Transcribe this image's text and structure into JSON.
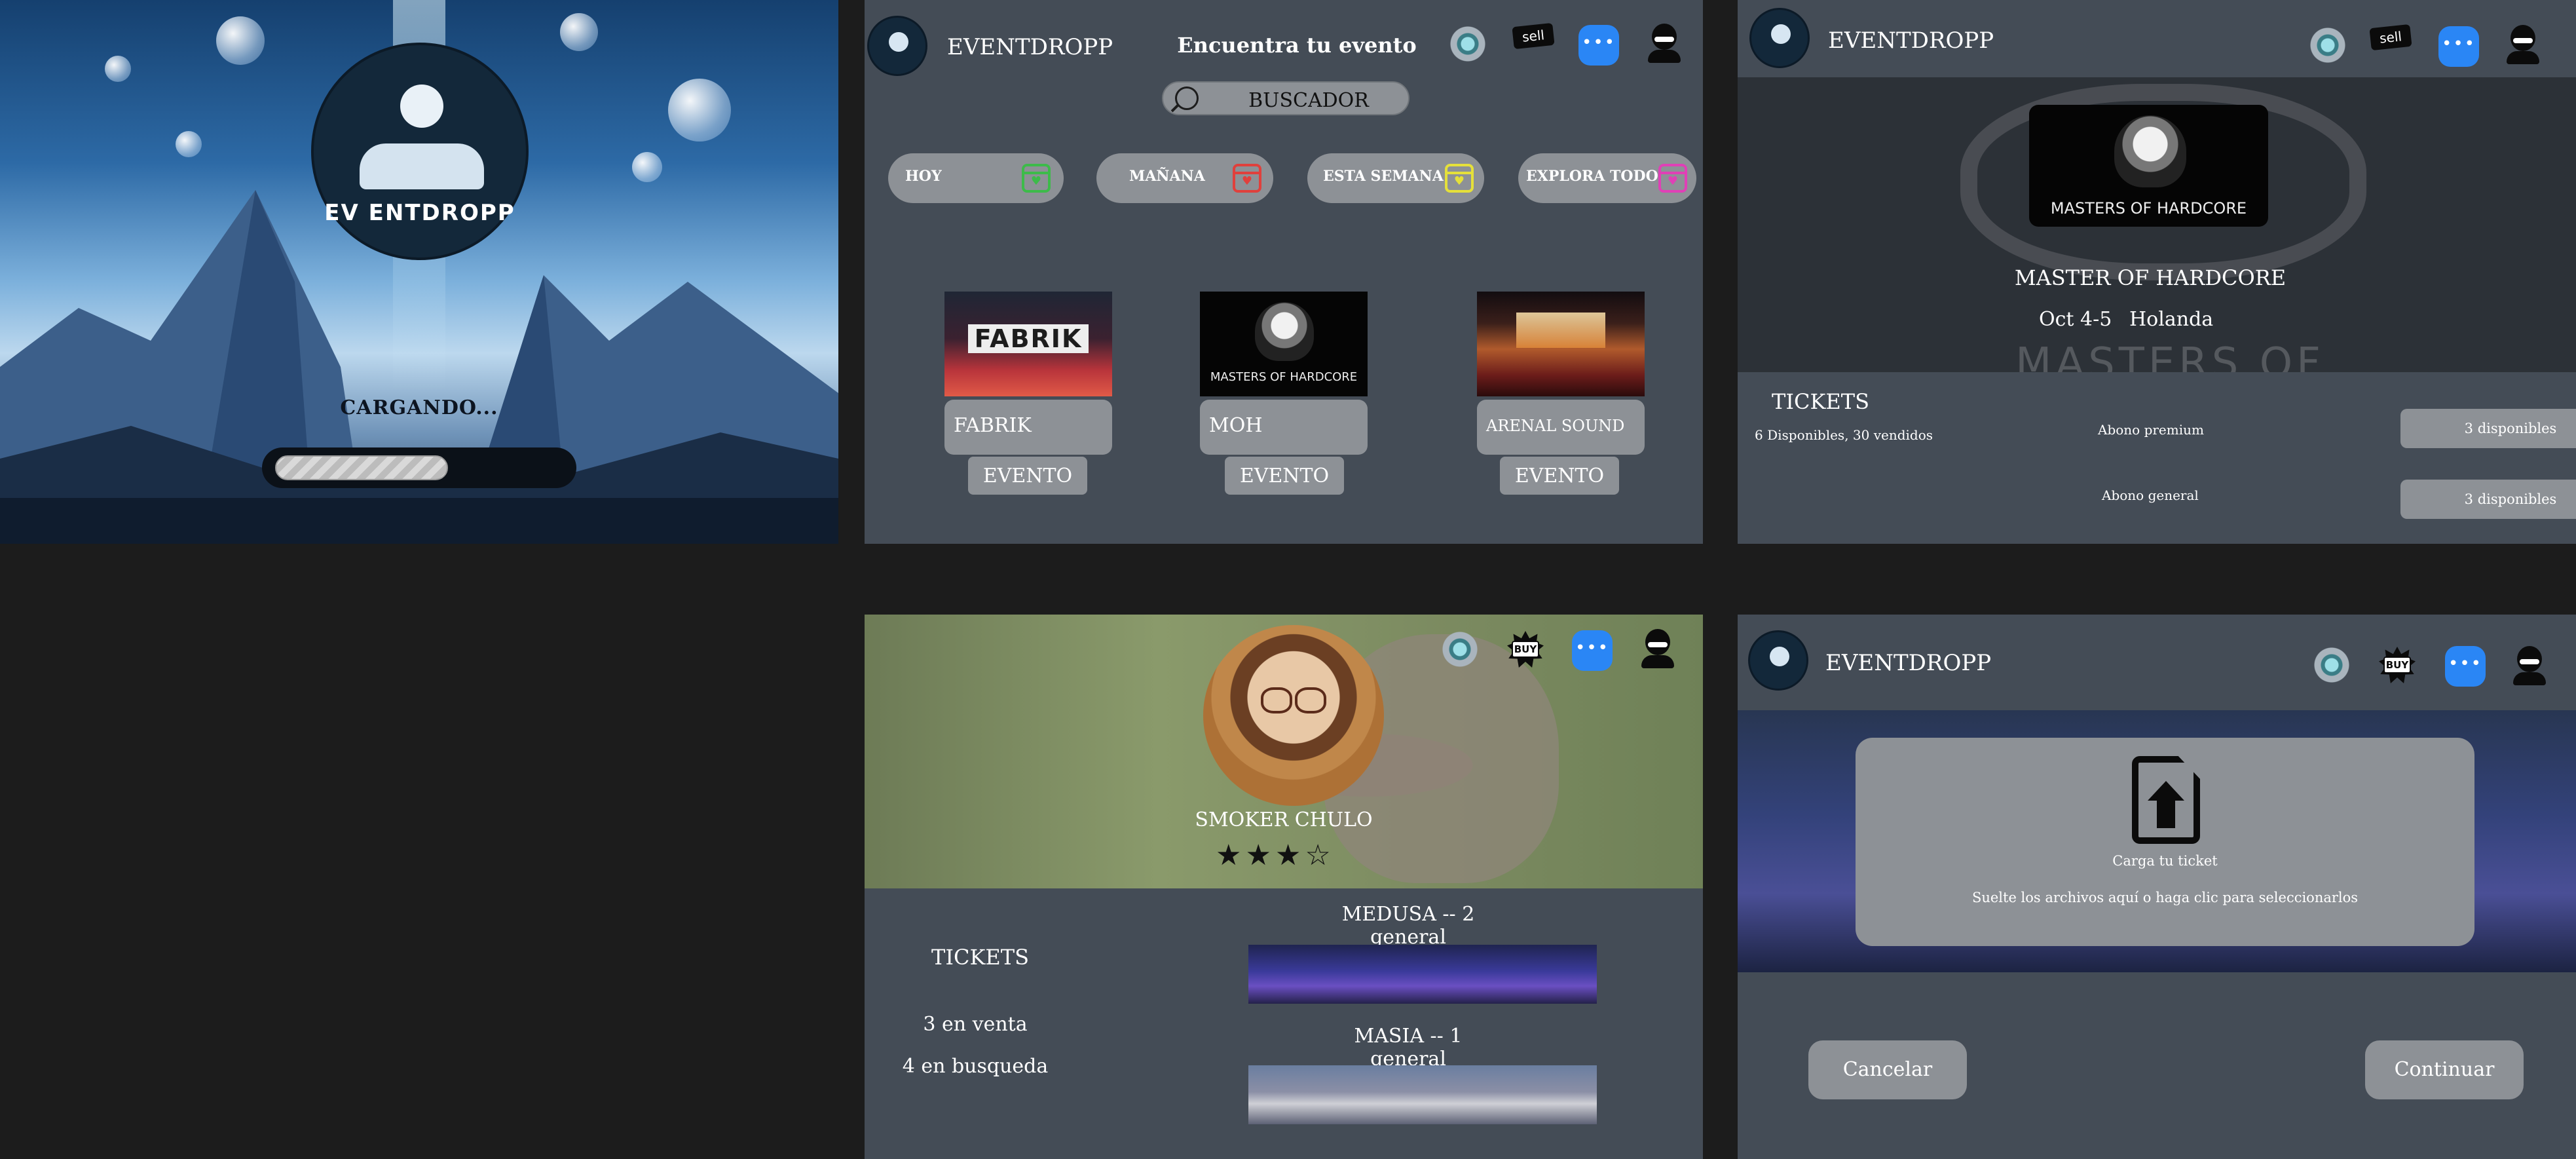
{
  "loading": {
    "logo_text": "EV ENTDROPP",
    "status": "CARGANDO...",
    "progress": 0.6
  },
  "app": {
    "brand": "EVENTDROPP",
    "sell_label": "sell",
    "buy_label": "BUY"
  },
  "search_screen": {
    "title": "Encuentra tu evento",
    "search_label": "BUSCADOR",
    "filters": [
      {
        "label": "HOY",
        "color": "#3dbb4a"
      },
      {
        "label": "MAÑANA",
        "color": "#e0403c"
      },
      {
        "label": "ESTA SEMANA",
        "color": "#e5e03a"
      },
      {
        "label": "EXPLORA TODO",
        "color": "#e040b6"
      }
    ],
    "events": [
      {
        "name": "FABRIK",
        "thumb_text": "FABRIK",
        "button": "EVENTO"
      },
      {
        "name": "MOH",
        "thumb_text": "MASTERS OF HARDCORE",
        "button": "EVENTO"
      },
      {
        "name": "ARENAL SOUND",
        "thumb_text": "",
        "button": "EVENTO"
      }
    ]
  },
  "event_detail": {
    "logo_text": "MASTERS OF HARDCORE",
    "watermark": "MASTERS OF HARDCORE",
    "title": "MASTER OF HARDCORE",
    "date": "Oct 4-5",
    "place": "Holanda",
    "tickets_heading": "TICKETS",
    "tickets_summary": "6 Disponibles, 30 vendidos",
    "ticket_types": [
      {
        "name": "Abono premium",
        "availability": "3 disponibles"
      },
      {
        "name": "Abono general",
        "availability": "3 disponibles"
      }
    ]
  },
  "profile": {
    "name": "SMOKER CHULO",
    "rating": 3,
    "rating_max": 4,
    "stars_text": "★★★☆",
    "tickets_heading": "TICKETS",
    "for_sale": "3 en venta",
    "searching": "4 en busqueda",
    "tickets": [
      {
        "title": "MEDUSA -- 2 general"
      },
      {
        "title": "MASIA -- 1 general"
      }
    ]
  },
  "upload": {
    "title": "Carga tu ticket",
    "hint": "Suelte los archivos aquí o haga clic para seleccionarlos",
    "cancel": "Cancelar",
    "continue": "Continuar"
  }
}
